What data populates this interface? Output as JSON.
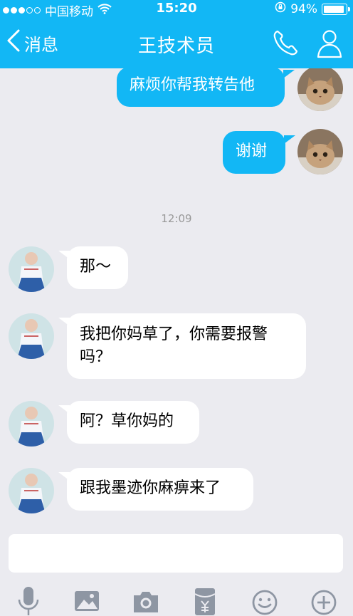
{
  "status": {
    "carrier": "中国移动",
    "time": "15:20",
    "battery": "94%",
    "battery_level": 0.94,
    "signal_bars": 3
  },
  "nav": {
    "back_label": "消息",
    "title": "王技术员"
  },
  "messages": {
    "m1": "麻烦你帮我转告他",
    "m2": "谢谢",
    "time": "12:09",
    "m3": "那～",
    "m4a": "我把你妈草了，你需要报警",
    "m4b": "吗？",
    "m5": "阿？草你妈的",
    "m6": "跟我墨迹你麻痹来了"
  },
  "colors": {
    "accent": "#12b7f5",
    "background": "#ebebf0"
  },
  "icons": {
    "back": "chevron-left-icon",
    "call": "phone-icon",
    "profile": "person-icon",
    "voice": "microphone-icon",
    "image": "image-icon",
    "camera": "camera-icon",
    "redpacket": "red-packet-icon",
    "emoji": "emoji-icon",
    "more": "plus-icon"
  }
}
